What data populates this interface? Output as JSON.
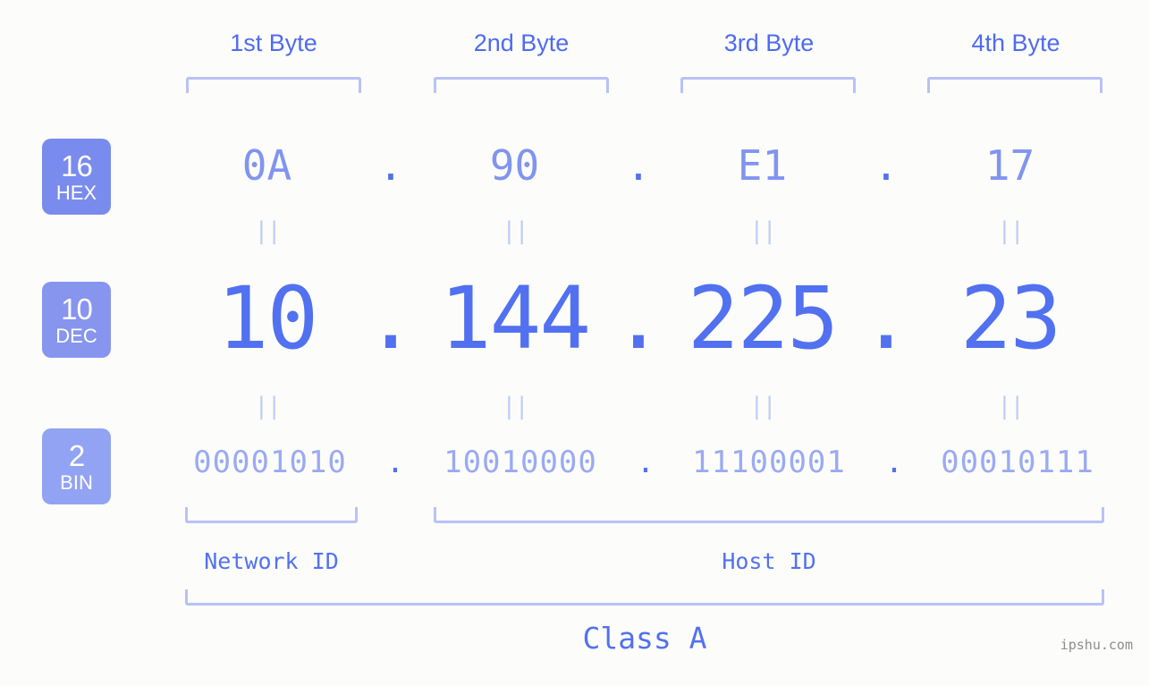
{
  "background_color": "#fcfdfa",
  "accent_color": "#5271f0",
  "muted_color": "#8194f0",
  "bracket_color": "#b8c2f7",
  "byte_headers": [
    {
      "label": "1st Byte"
    },
    {
      "label": "2nd Byte"
    },
    {
      "label": "3rd Byte"
    },
    {
      "label": "4th Byte"
    }
  ],
  "rows": [
    {
      "badge": {
        "base": "16",
        "system": "HEX"
      },
      "values": [
        "0A",
        "90",
        "E1",
        "17"
      ],
      "separator": "."
    },
    {
      "badge": {
        "base": "10",
        "system": "DEC"
      },
      "values": [
        "10",
        "144",
        "225",
        "23"
      ],
      "separator": "."
    },
    {
      "badge": {
        "base": "2",
        "system": "BIN"
      },
      "values": [
        "00001010",
        "10010000",
        "11100001",
        "00010111"
      ],
      "separator": "."
    }
  ],
  "equality_marks": [
    "||",
    "||",
    "||",
    "||",
    "||",
    "||",
    "||",
    "||"
  ],
  "sections": {
    "network_id": "Network ID",
    "host_id": "Host ID",
    "class": "Class A"
  },
  "watermark": "ipshu.com"
}
